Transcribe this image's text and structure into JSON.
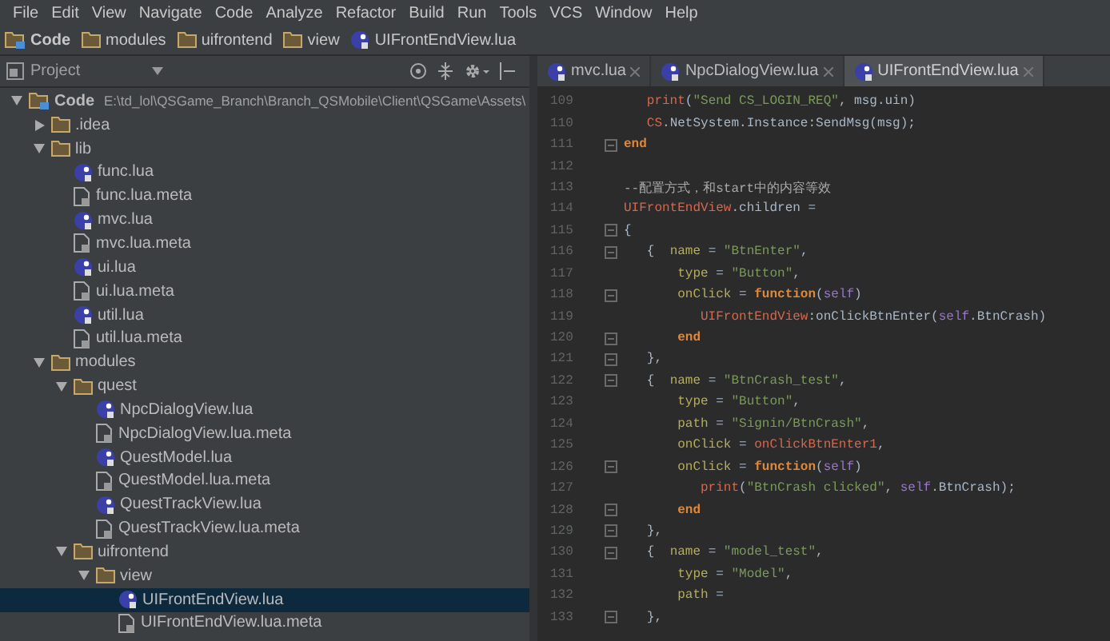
{
  "menu": [
    "File",
    "Edit",
    "View",
    "Navigate",
    "Code",
    "Analyze",
    "Refactor",
    "Build",
    "Run",
    "Tools",
    "VCS",
    "Window",
    "Help"
  ],
  "breadcrumbs": [
    {
      "label": "Code",
      "kind": "module"
    },
    {
      "label": "modules",
      "kind": "folder"
    },
    {
      "label": "uifrontend",
      "kind": "folder"
    },
    {
      "label": "view",
      "kind": "folder"
    },
    {
      "label": "UIFrontEndView.lua",
      "kind": "lua"
    }
  ],
  "project_panel": {
    "title": "Project",
    "tree": [
      {
        "label": "Code",
        "path": "E:\\td_lol\\QSGame_Branch\\Branch_QSMobile\\Client\\QSGame\\Assets\\",
        "kind": "module",
        "expanded": true,
        "selected": false,
        "children": [
          {
            "label": ".idea",
            "kind": "folder",
            "expanded": false,
            "selected": false
          },
          {
            "label": "lib",
            "kind": "folder",
            "expanded": true,
            "selected": false,
            "children": [
              {
                "label": "func.lua",
                "kind": "lua",
                "selected": false
              },
              {
                "label": "func.lua.meta",
                "kind": "meta",
                "selected": false
              },
              {
                "label": "mvc.lua",
                "kind": "lua",
                "selected": false
              },
              {
                "label": "mvc.lua.meta",
                "kind": "meta",
                "selected": false
              },
              {
                "label": "ui.lua",
                "kind": "lua",
                "selected": false
              },
              {
                "label": "ui.lua.meta",
                "kind": "meta",
                "selected": false
              },
              {
                "label": "util.lua",
                "kind": "lua",
                "selected": false
              },
              {
                "label": "util.lua.meta",
                "kind": "meta",
                "selected": false
              }
            ]
          },
          {
            "label": "modules",
            "kind": "folder",
            "expanded": true,
            "selected": false,
            "children": [
              {
                "label": "quest",
                "kind": "folder",
                "expanded": true,
                "selected": false,
                "children": [
                  {
                    "label": "NpcDialogView.lua",
                    "kind": "lua",
                    "selected": false
                  },
                  {
                    "label": "NpcDialogView.lua.meta",
                    "kind": "meta",
                    "selected": false
                  },
                  {
                    "label": "QuestModel.lua",
                    "kind": "lua",
                    "selected": false
                  },
                  {
                    "label": "QuestModel.lua.meta",
                    "kind": "meta",
                    "selected": false
                  },
                  {
                    "label": "QuestTrackView.lua",
                    "kind": "lua",
                    "selected": false
                  },
                  {
                    "label": "QuestTrackView.lua.meta",
                    "kind": "meta",
                    "selected": false
                  }
                ]
              },
              {
                "label": "uifrontend",
                "kind": "folder",
                "expanded": true,
                "selected": false,
                "children": [
                  {
                    "label": "view",
                    "kind": "folder",
                    "expanded": true,
                    "selected": false,
                    "children": [
                      {
                        "label": "UIFrontEndView.lua",
                        "kind": "lua",
                        "selected": true
                      },
                      {
                        "label": "UIFrontEndView.lua.meta",
                        "kind": "meta",
                        "selected": false
                      }
                    ]
                  }
                ]
              }
            ]
          }
        ]
      }
    ]
  },
  "editor": {
    "tabs": [
      {
        "label": "mvc.lua",
        "selected": false
      },
      {
        "label": "NpcDialogView.lua",
        "selected": false
      },
      {
        "label": "UIFrontEndView.lua",
        "selected": true
      }
    ],
    "lines": [
      {
        "num": "109",
        "fold": false,
        "tokens": [
          {
            "text": "   print",
            "kind": "global"
          },
          {
            "text": "(",
            "kind": "plain"
          },
          {
            "text": "\"Send CS_LOGIN_REQ\"",
            "kind": "string"
          },
          {
            "text": ", msg.uin)",
            "kind": "plain"
          }
        ]
      },
      {
        "num": "110",
        "fold": false,
        "tokens": [
          {
            "text": "   CS",
            "kind": "global"
          },
          {
            "text": ".NetSystem.Instance:SendMsg(msg);",
            "kind": "plain"
          }
        ]
      },
      {
        "num": "111",
        "fold": true,
        "tokens": [
          {
            "text": "end",
            "kind": "keyword"
          }
        ]
      },
      {
        "num": "112",
        "fold": false
      },
      {
        "num": "113",
        "fold": false,
        "tokens": [
          {
            "text": "--配置方式，和start中的内容等效",
            "kind": "comment"
          }
        ]
      },
      {
        "num": "114",
        "fold": false,
        "tokens": [
          {
            "text": "UIFrontEndView",
            "kind": "global"
          },
          {
            "text": ".children =",
            "kind": "plain"
          }
        ]
      },
      {
        "num": "115",
        "fold": true,
        "tokens": [
          {
            "text": "{",
            "kind": "plain"
          }
        ]
      },
      {
        "num": "116",
        "fold": true,
        "tokens": [
          {
            "text": "   {  ",
            "kind": "plain"
          },
          {
            "text": "name",
            "kind": "field"
          },
          {
            "text": " = ",
            "kind": "plain"
          },
          {
            "text": "\"BtnEnter\"",
            "kind": "string"
          },
          {
            "text": ",",
            "kind": "plain"
          }
        ]
      },
      {
        "num": "117",
        "fold": false,
        "tokens": [
          {
            "text": "       type",
            "kind": "field"
          },
          {
            "text": " = ",
            "kind": "plain"
          },
          {
            "text": "\"Button\"",
            "kind": "string"
          },
          {
            "text": ",",
            "kind": "plain"
          }
        ]
      },
      {
        "num": "118",
        "fold": true,
        "tokens": [
          {
            "text": "       onClick",
            "kind": "field"
          },
          {
            "text": " = ",
            "kind": "plain"
          },
          {
            "text": "function",
            "kind": "keyword"
          },
          {
            "text": "(",
            "kind": "plain"
          },
          {
            "text": "self",
            "kind": "self"
          },
          {
            "text": ")",
            "kind": "plain"
          }
        ]
      },
      {
        "num": "119",
        "fold": false,
        "tokens": [
          {
            "text": "          UIFrontEndView",
            "kind": "global"
          },
          {
            "text": ":onClickBtnEnter(",
            "kind": "plain"
          },
          {
            "text": "self",
            "kind": "self"
          },
          {
            "text": ".BtnCrash)",
            "kind": "plain"
          }
        ]
      },
      {
        "num": "120",
        "fold": true,
        "tokens": [
          {
            "text": "       end",
            "kind": "keyword"
          }
        ]
      },
      {
        "num": "121",
        "fold": true,
        "tokens": [
          {
            "text": "   },",
            "kind": "plain"
          }
        ]
      },
      {
        "num": "122",
        "fold": true,
        "tokens": [
          {
            "text": "   {  ",
            "kind": "plain"
          },
          {
            "text": "name",
            "kind": "field"
          },
          {
            "text": " = ",
            "kind": "plain"
          },
          {
            "text": "\"BtnCrash_test\"",
            "kind": "string"
          },
          {
            "text": ",",
            "kind": "plain"
          }
        ]
      },
      {
        "num": "123",
        "fold": false,
        "tokens": [
          {
            "text": "       type",
            "kind": "field"
          },
          {
            "text": " = ",
            "kind": "plain"
          },
          {
            "text": "\"Button\"",
            "kind": "string"
          },
          {
            "text": ",",
            "kind": "plain"
          }
        ]
      },
      {
        "num": "124",
        "fold": false,
        "tokens": [
          {
            "text": "       path",
            "kind": "field"
          },
          {
            "text": " = ",
            "kind": "plain"
          },
          {
            "text": "\"Signin/BtnCrash\"",
            "kind": "string"
          },
          {
            "text": ",",
            "kind": "plain"
          }
        ]
      },
      {
        "num": "125",
        "fold": false,
        "tokens": [
          {
            "text": "       onClick",
            "kind": "field"
          },
          {
            "text": " = ",
            "kind": "plain"
          },
          {
            "text": "onClickBtnEnter1",
            "kind": "global"
          },
          {
            "text": ",",
            "kind": "plain"
          }
        ]
      },
      {
        "num": "126",
        "fold": true,
        "tokens": [
          {
            "text": "       onClick",
            "kind": "field"
          },
          {
            "text": " = ",
            "kind": "plain"
          },
          {
            "text": "function",
            "kind": "keyword"
          },
          {
            "text": "(",
            "kind": "plain"
          },
          {
            "text": "self",
            "kind": "self"
          },
          {
            "text": ")",
            "kind": "plain"
          }
        ]
      },
      {
        "num": "127",
        "fold": false,
        "tokens": [
          {
            "text": "          print",
            "kind": "global"
          },
          {
            "text": "(",
            "kind": "plain"
          },
          {
            "text": "\"BtnCrash clicked\"",
            "kind": "string"
          },
          {
            "text": ", ",
            "kind": "plain"
          },
          {
            "text": "self",
            "kind": "self"
          },
          {
            "text": ".BtnCrash);",
            "kind": "plain"
          }
        ]
      },
      {
        "num": "128",
        "fold": true,
        "tokens": [
          {
            "text": "       end",
            "kind": "keyword"
          }
        ]
      },
      {
        "num": "129",
        "fold": true,
        "tokens": [
          {
            "text": "   },",
            "kind": "plain"
          }
        ]
      },
      {
        "num": "130",
        "fold": true,
        "tokens": [
          {
            "text": "   {  ",
            "kind": "plain"
          },
          {
            "text": "name",
            "kind": "field"
          },
          {
            "text": " = ",
            "kind": "plain"
          },
          {
            "text": "\"model_test\"",
            "kind": "string"
          },
          {
            "text": ",",
            "kind": "plain"
          }
        ]
      },
      {
        "num": "131",
        "fold": false,
        "tokens": [
          {
            "text": "       type",
            "kind": "field"
          },
          {
            "text": " = ",
            "kind": "plain"
          },
          {
            "text": "\"Model\"",
            "kind": "string"
          },
          {
            "text": ",",
            "kind": "plain"
          }
        ]
      },
      {
        "num": "132",
        "fold": false,
        "tokens": [
          {
            "text": "       path",
            "kind": "field"
          },
          {
            "text": " =",
            "kind": "plain"
          }
        ]
      },
      {
        "num": "133",
        "fold": true,
        "tokens": [
          {
            "text": "   },",
            "kind": "plain"
          }
        ]
      }
    ]
  }
}
